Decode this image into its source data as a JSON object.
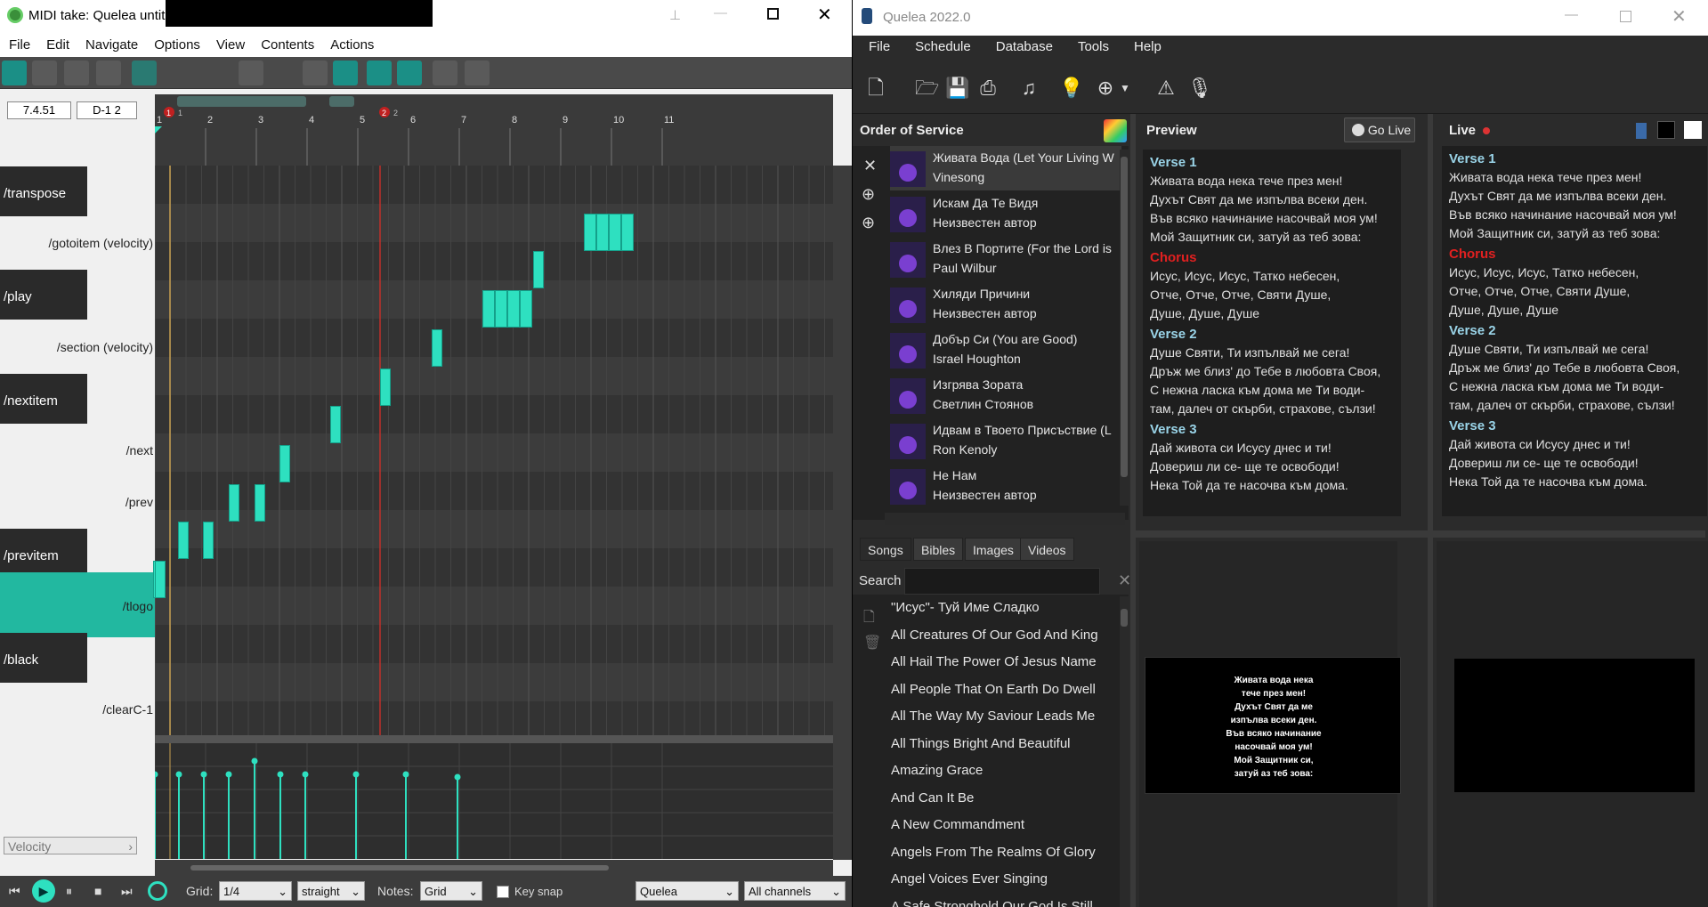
{
  "midi": {
    "title": "MIDI take: Quelea untit",
    "menu": [
      "File",
      "Edit",
      "Navigate",
      "Options",
      "View",
      "Contents",
      "Actions"
    ],
    "position": "7.4.51",
    "pitch": "D-1  2",
    "ruler_marks": [
      "1",
      "2",
      "3",
      "4",
      "5",
      "6",
      "7",
      "8",
      "9",
      "10",
      "11"
    ],
    "markers": [
      "1",
      "2"
    ],
    "marker_labels": [
      "1",
      "2"
    ],
    "rows": [
      {
        "label": "/transpose",
        "black": true
      },
      {
        "label": "/gotoitem (velocity)",
        "black": false
      },
      {
        "label": "/play",
        "black": true
      },
      {
        "label": "/section (velocity)",
        "black": false
      },
      {
        "label": "/nextitem",
        "black": true
      },
      {
        "label": "/next",
        "black": false
      },
      {
        "label": "/prev",
        "black": false
      },
      {
        "label": "/previtem",
        "black": true
      },
      {
        "label": "/tlogo",
        "black": false
      },
      {
        "label": "/black",
        "black": true
      },
      {
        "label": "/clearC-1",
        "black": false
      }
    ],
    "lane_select": "Velocity",
    "grid_label": "Grid:",
    "grid_value": "1/4",
    "swing_value": "straight",
    "notes_label": "Notes:",
    "notes_value": "Grid",
    "keysnap_label": "Key snap",
    "instrument": "Quelea",
    "channels": "All channels",
    "accent": "#2ee0c0"
  },
  "quelea": {
    "title": "Quelea 2022.0",
    "menu": [
      "File",
      "Schedule",
      "Database",
      "Tools",
      "Help"
    ],
    "order_title": "Order of Service",
    "preview_title": "Preview",
    "go_live": "Go Live",
    "live_title": "Live",
    "schedule": [
      {
        "title": "Живата Вода (Let Your Living W",
        "author": "Vinesong"
      },
      {
        "title": "Искам Да Те Видя",
        "author": "Неизвестен автор"
      },
      {
        "title": "Влез В Портите (For the Lord is",
        "author": "Paul Wilbur"
      },
      {
        "title": "Хиляди Причини",
        "author": "Неизвестен автор"
      },
      {
        "title": "Добър Си (You are Good)",
        "author": "Israel Houghton"
      },
      {
        "title": "Изгрява Зората",
        "author": "Светлин Стоянов"
      },
      {
        "title": "Идвам в Твоето Присъствие (L",
        "author": "Ron Kenoly"
      },
      {
        "title": "Не Нам",
        "author": "Неизвестен автор"
      }
    ],
    "lyrics": [
      {
        "head": "Verse 1",
        "type": "v",
        "lines": [
          "Живата вода нека тече през мен!",
          "Духът Свят да ме изпълва всеки ден.",
          "Във всяко начинание насочвай моя ум!",
          "Мой Защитник си, затуй аз теб зова:"
        ]
      },
      {
        "head": "Chorus",
        "type": "c",
        "lines": [
          "Исус, Исус, Исус,  Татко небесен,",
          "Отче, Отче, Отче,  Святи Душе,",
          "Душе, Душе, Душе"
        ]
      },
      {
        "head": "Verse 2",
        "type": "v",
        "lines": [
          "Душе Святи, Ти изпълвай ме сега!",
          "Дръж ме близ' до Тебе в любовта Своя,",
          "С нежна ласка към дома ме Ти води-",
          "там, далеч от скърби, страхове, сълзи!"
        ]
      },
      {
        "head": "Verse 3",
        "type": "v",
        "lines": [
          "Дай живота си Исусу днес и ти!",
          "Довериш ли се- ще те освободи!",
          "Нека Той да те насочва към дома."
        ]
      }
    ],
    "tabs": [
      "Songs",
      "Bibles",
      "Images",
      "Videos"
    ],
    "search_label": "Search",
    "search_value": "",
    "songs": [
      "\"Исус\"- Туй Име Сладко",
      "All Creatures Of Our God And King",
      "All Hail The Power Of Jesus Name",
      "All People That On Earth Do Dwell",
      "All The Way My Saviour Leads Me",
      "All Things Bright And Beautiful",
      "Amazing Grace",
      "And Can It Be",
      "A New Commandment",
      "Angels From The Realms Of Glory",
      "Angel Voices Ever Singing",
      "A Safe Stronghold Our God Is Still"
    ],
    "preview_slide": [
      "Живата вода нека",
      "тече през мен!",
      "Духът Свят да ме",
      "изпълва всеки ден.",
      "Във всяко начинание",
      "насочвай моя ум!",
      "Мой Защитник си,",
      "затуй аз теб зова:"
    ]
  }
}
